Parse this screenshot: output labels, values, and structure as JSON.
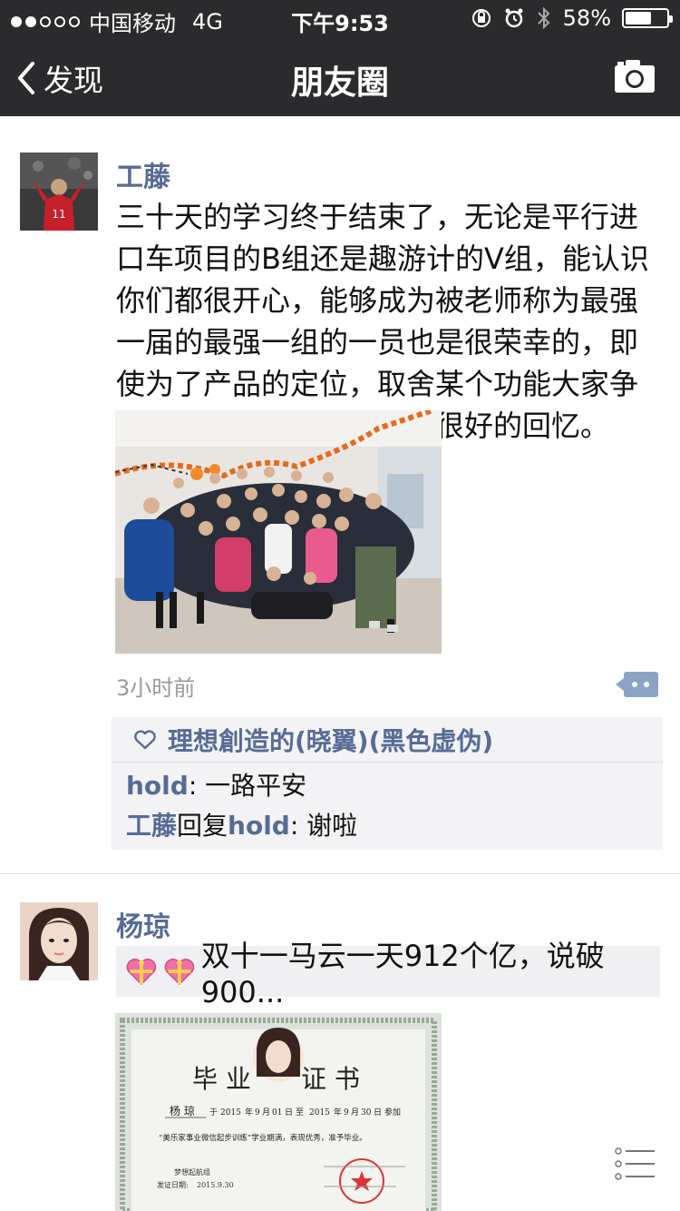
{
  "status_bar": {
    "carrier": "中国移动",
    "network": "4G",
    "time": "下午9:53",
    "battery": "58%",
    "signal_bars": 2
  },
  "nav": {
    "back_label": "发现",
    "title": "朋友圈"
  },
  "posts": [
    {
      "author": "工藤",
      "text": "三十天的学习终于结束了，无论是平行进口车项目的B组还是趣游计的V组，能认识你们都很开心，能够成为被老师称为最强一届的最强一组的一员也是很荣幸的，即使为了产品的定位，取舍某个功能大家争得面红耳赤，这也是一段很好的回忆。",
      "time": "3小时前",
      "likes": "理想創造的(晓翼)(黑色虚伪)",
      "comments": [
        {
          "user": "hold",
          "text": ": 一路平安"
        },
        {
          "user": "工藤",
          "reply_label": "回复",
          "reply_to": "hold",
          "text": ": 谢啦"
        }
      ]
    },
    {
      "author": "杨琼",
      "share_text": "双十一马云一天912个亿，说破900...",
      "certificate": {
        "title_left": "毕 业",
        "title_right": "证 书",
        "name": "杨 琼",
        "line1_a": "于",
        "from_year": "2015",
        "from_month": "9",
        "from_day": "01",
        "to": "至",
        "to_year": "2015",
        "to_month": "9",
        "to_day": "30",
        "line1_b": "参加",
        "year_unit": "年",
        "month_unit": "月",
        "day_unit": "日",
        "line2": "“美乐家事业微信起步训练”学业期满，表现优秀，准予毕业。",
        "group": "梦想起航组",
        "issue_label": "发证日期:",
        "issue_date": "2015.9.30"
      }
    }
  ],
  "colors": {
    "bar_bg": "#2b2b2d",
    "link": "#576b95",
    "comment_bg": "#f3f3f5"
  }
}
